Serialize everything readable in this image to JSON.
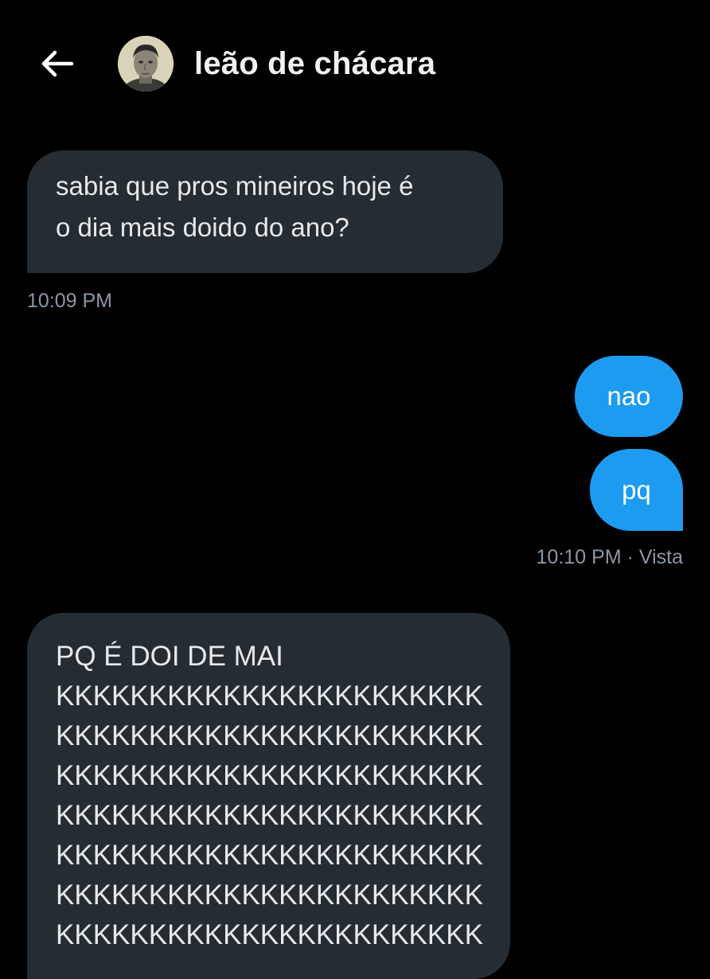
{
  "header": {
    "back_icon": "arrow-left-icon",
    "title": "leão de chácara"
  },
  "messages": [
    {
      "direction": "received",
      "text": "sabia que pros mineiros hoje é\no dia mais doido do ano?",
      "timestamp": "10:09 PM"
    },
    {
      "direction": "sent",
      "text": "nao"
    },
    {
      "direction": "sent",
      "text": "pq",
      "timestamp": "10:10 PM · Vista"
    },
    {
      "direction": "received",
      "text": "PQ É DOI DE MAI\nKKKKKKKKKKKKKKKKKKKKKKK\nKKKKKKKKKKKKKKKKKKKKKKK\nKKKKKKKKKKKKKKKKKKKKKKK\nKKKKKKKKKKKKKKKKKKKKKKK\nKKKKKKKKKKKKKKKKKKKKKKK\nKKKKKKKKKKKKKKKKKKKKKKK\nKKKKKKKKKKKKKKKKKKKKKKK"
    }
  ],
  "colors": {
    "background": "#000000",
    "received_bubble": "#252d33",
    "sent_bubble": "#1d9bf0",
    "timestamp": "#8b98a5"
  }
}
